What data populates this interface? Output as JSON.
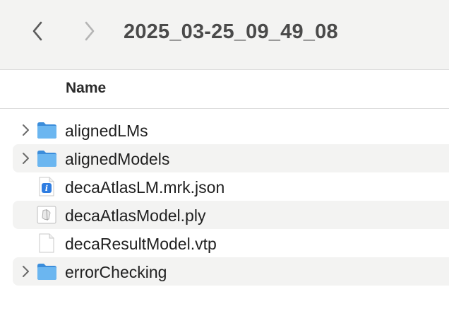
{
  "window": {
    "title": "2025_03-25_09_49_08"
  },
  "toolbar": {
    "back_icon": "chevron-left-icon",
    "forward_icon": "chevron-right-icon"
  },
  "columns": {
    "name": "Name"
  },
  "colors": {
    "folder": "#5aa8e6",
    "striped_row": "#f3f3f2",
    "toolbar_bg": "#f3f3f2"
  },
  "files": [
    {
      "name": "alignedLMs",
      "kind": "folder",
      "icon": "folder-icon",
      "expandable": true
    },
    {
      "name": "alignedModels",
      "kind": "folder",
      "icon": "folder-icon",
      "expandable": true
    },
    {
      "name": "decaAtlasLM.mrk.json",
      "kind": "json",
      "icon": "json-file-icon",
      "expandable": false
    },
    {
      "name": "decaAtlasModel.ply",
      "kind": "ply",
      "icon": "ply-file-icon",
      "expandable": false
    },
    {
      "name": "decaResultModel.vtp",
      "kind": "document",
      "icon": "blank-document-icon",
      "expandable": false
    },
    {
      "name": "errorChecking",
      "kind": "folder",
      "icon": "folder-icon",
      "expandable": true
    }
  ]
}
